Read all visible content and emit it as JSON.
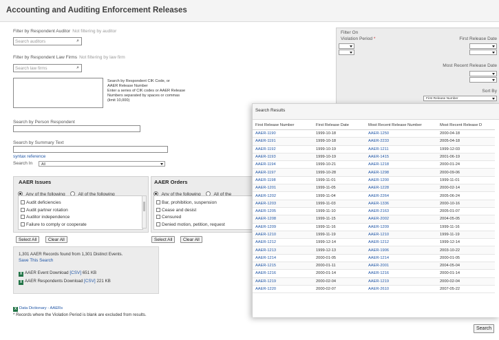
{
  "page": {
    "title": "Accounting and Auditing Enforcement Releases"
  },
  "auditor_filter": {
    "label": "Filter by Respondent Auditor",
    "note": "Not filtering by auditor",
    "placeholder": "Search auditors"
  },
  "lawfirm_filter": {
    "label": "Filter by Respondent Law Firms",
    "note": "Not filtering by law firm",
    "placeholder": "Search law firms"
  },
  "cik_hint": [
    "Search by Respondent CIK Code, or",
    "AAER Release Number",
    "Enter a series of CIK codes or AAER Release",
    "Numbers separated by spaces or commas",
    "(limit 10,000)"
  ],
  "person": {
    "label": "Search by Person Respondent"
  },
  "summary": {
    "label": "Search by Summary Text",
    "syntax_link": "syntax reference",
    "search_in_label": "Search In",
    "search_in_value": "All"
  },
  "issues": {
    "title": "AAER Issues",
    "radio_any": "Any of the following",
    "radio_all": "All of the following",
    "items": [
      "Audit deficiencies",
      "Audit partner rotation",
      "Auditor independence",
      "Failure to comply or cooperate"
    ],
    "select_all": "Select All",
    "clear_all": "Clear All"
  },
  "orders": {
    "title": "AAER Orders",
    "radio_any": "Any of the following",
    "radio_all": "All of the",
    "items": [
      "Bar, prohibition, suspension",
      "Cease and desist",
      "Censured",
      "Denied motion, petition, request"
    ],
    "select_all": "Select All",
    "clear_all": "Clear All"
  },
  "results_info": {
    "summary": "1,301 AAER Records found from 1,301 Distinct Events.",
    "save_link": "Save This Search",
    "event_download": "AAER Event Download",
    "event_csv": "[CSV]",
    "event_size": "651 KB",
    "respondents_download": "AAER Respondents Download",
    "respondents_csv": "[CSV]",
    "respondents_size": "221 KB",
    "excel_icon": "excel-icon"
  },
  "data_dictionary": {
    "link": "Data Dictionary - AAERs"
  },
  "footnote": "* Records where the Violation Period is blank are excluded from results.",
  "filter_on": {
    "title": "Filter On",
    "violation_label": "Violation Period",
    "violation_required": "*",
    "first_release_label": "First Release Date",
    "recent_release_label": "Most Recent Release Date",
    "sort_label": "Sort By",
    "sort_value": "First Release Number"
  },
  "results": {
    "title": "Search Results",
    "columns": [
      "First Release Number",
      "First Release Date",
      "Most Recent Release Number",
      "Most Recent Release D"
    ],
    "rows": [
      [
        "AAER-1190",
        "1999-10-18",
        "AAER-1250",
        "2000-04-18"
      ],
      [
        "AAER-1191",
        "1999-10-18",
        "AAER-2233",
        "2005-04-18"
      ],
      [
        "AAER-1192",
        "1999-10-19",
        "AAER-1211",
        "1999-12-03"
      ],
      [
        "AAER-1193",
        "1999-10-19",
        "AAER-1415",
        "2001-06-19"
      ],
      [
        "AAER-1194",
        "1999-10-21",
        "AAER-1218",
        "2000-01-24"
      ],
      [
        "AAER-1197",
        "1999-10-28",
        "AAER-1298",
        "2000-09-06"
      ],
      [
        "AAER-1198",
        "1999-11-01",
        "AAER-1200",
        "1999-11-01"
      ],
      [
        "AAER-1201",
        "1999-11-05",
        "AAER-1228",
        "2000-02-14"
      ],
      [
        "AAER-1202",
        "1999-11-04",
        "AAER-2264",
        "2005-06-24"
      ],
      [
        "AAER-1203",
        "1999-11-03",
        "AAER-1336",
        "2000-10-16"
      ],
      [
        "AAER-1205",
        "1999-11-10",
        "AAER-2163",
        "2005-01-07"
      ],
      [
        "AAER-1208",
        "1999-11-15",
        "AAER-2002",
        "2004-05-05"
      ],
      [
        "AAER-1209",
        "1999-11-16",
        "AAER-1209",
        "1999-11-16"
      ],
      [
        "AAER-1210",
        "1999-11-19",
        "AAER-1210",
        "1999-11-19"
      ],
      [
        "AAER-1212",
        "1999-12-14",
        "AAER-1212",
        "1999-12-14"
      ],
      [
        "AAER-1213",
        "1999-12-13",
        "AAER-1906",
        "2003-10-22"
      ],
      [
        "AAER-1214",
        "2000-01-05",
        "AAER-1214",
        "2000-01-05"
      ],
      [
        "AAER-1215",
        "2000-01-11",
        "AAER-2001",
        "2004-05-04"
      ],
      [
        "AAER-1216",
        "2000-01-14",
        "AAER-1216",
        "2000-01-14"
      ],
      [
        "AAER-1219",
        "2000-02-04",
        "AAER-1219",
        "2000-02-04"
      ],
      [
        "AAER-1220",
        "2000-02-07",
        "AAER-2610",
        "2007-05-22"
      ]
    ]
  },
  "search_button": "Search",
  "icons": {
    "search": "search-icon",
    "dropdown": "chevron-down-icon"
  }
}
